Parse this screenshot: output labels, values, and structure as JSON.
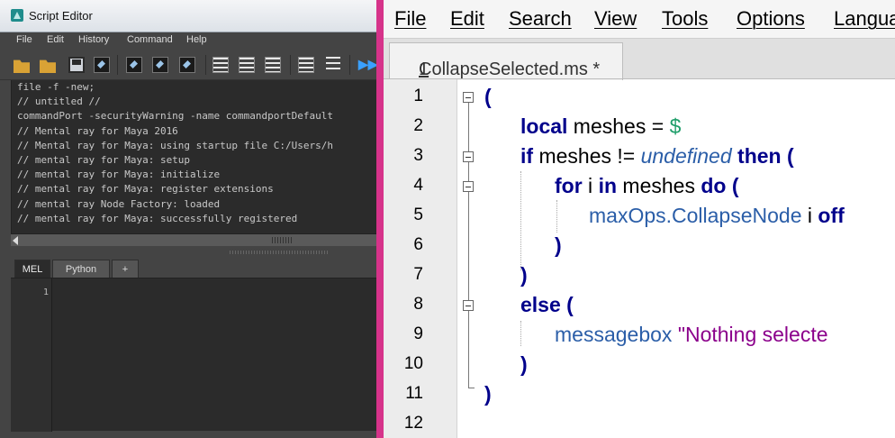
{
  "maya": {
    "title": "Script Editor",
    "menu": [
      "File",
      "Edit",
      "History",
      "Command",
      "Help"
    ],
    "toolbar_icons": [
      "open-script-icon",
      "source-script-icon",
      "save-script-icon",
      "save-to-shelf-icon",
      "clear-history-icon",
      "clear-input-icon",
      "clear-all-icon",
      "show-history-icon",
      "show-input-icon",
      "show-both-icon",
      "echo-all-icon",
      "line-numbers-icon",
      "execute-icon"
    ],
    "output_lines": [
      "file -f -new;",
      "// untitled //",
      "commandPort -securityWarning -name commandportDefault",
      "// Mental ray for Maya 2016",
      "// Mental ray for Maya: using startup file C:/Users/h",
      "// mental ray for Maya: setup",
      "// mental ray for Maya: initialize",
      "// mental ray for Maya: register extensions",
      "// mental ray Node Factory: loaded",
      "// mental ray for Maya: successfully registered"
    ],
    "tabs": [
      "MEL",
      "Python",
      "+"
    ],
    "editor_line": "1"
  },
  "mxs": {
    "menu": [
      "File",
      "Edit",
      "Search",
      "View",
      "Tools",
      "Options",
      "Langua"
    ],
    "tab_number": "1",
    "tab_title": "CollapseSelected.ms *",
    "line_numbers": [
      "1",
      "2",
      "3",
      "4",
      "5",
      "6",
      "7",
      "8",
      "9",
      "10",
      "11",
      "12"
    ],
    "code": {
      "l1": "(",
      "l2_local": "local",
      "l2_rest": " meshes = ",
      "l2_dollar": "$",
      "l3_if": "if",
      "l3_mid": " meshes != ",
      "l3_undef": "undefined",
      "l3_then": "then",
      "l3_paren": " (",
      "l4_for": "for",
      "l4_i": " i ",
      "l4_in": "in",
      "l4_meshes": " meshes ",
      "l4_do": "do",
      "l4_paren": " (",
      "l5_fn": "maxOps.CollapseNode",
      "l5_i": " i ",
      "l5_off": "off",
      "l6": ")",
      "l7": ")",
      "l8_else": "else",
      "l8_paren": " (",
      "l9_fn": "messagebox",
      "l9_str": "\"Nothing selecte",
      "l10": ")",
      "l11": ")"
    }
  }
}
